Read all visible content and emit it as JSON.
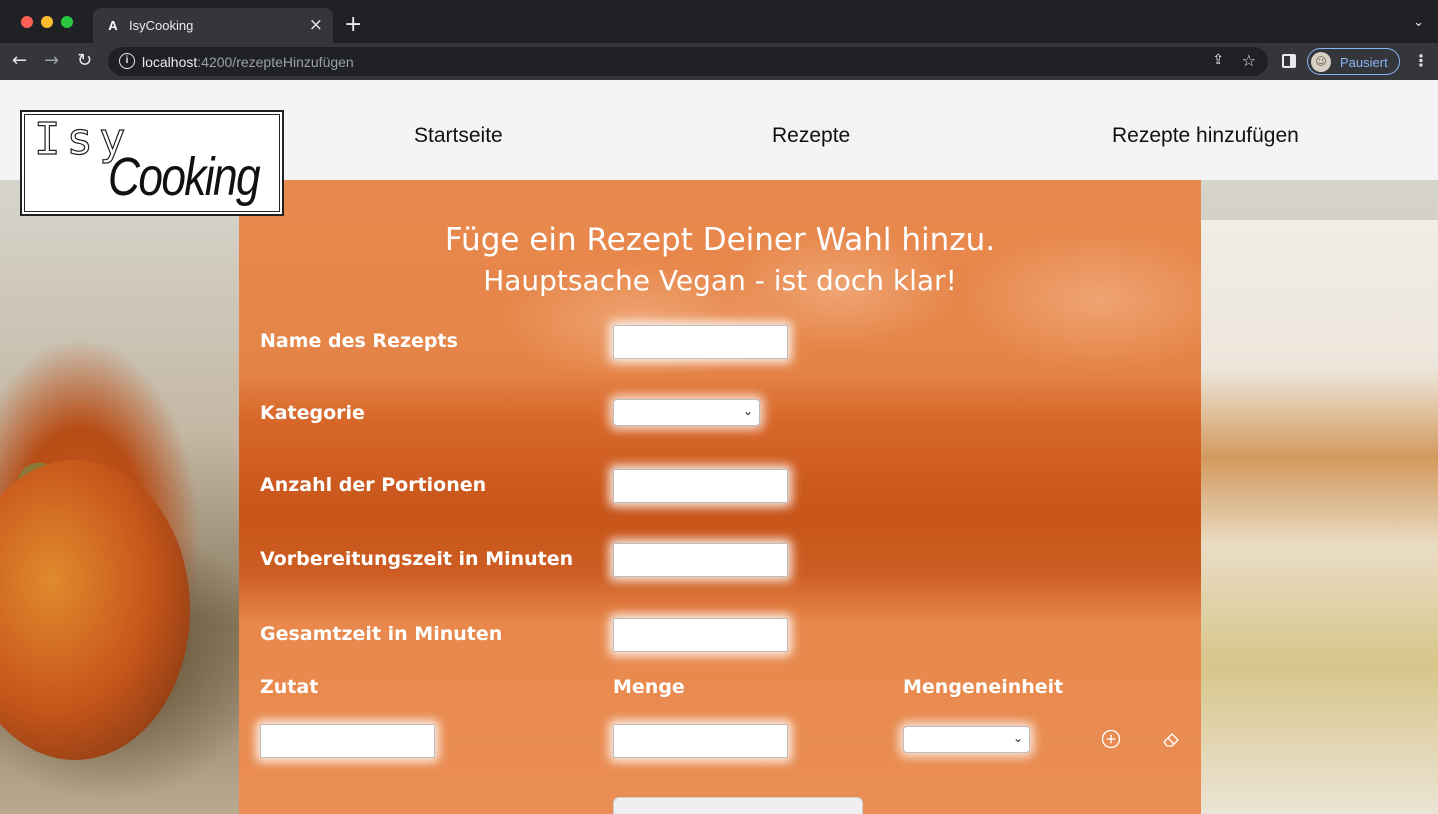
{
  "browser": {
    "tab_title": "IsyCooking",
    "tab_favicon": "A",
    "url_host": "localhost",
    "url_path": ":4200/rezepteHinzufügen",
    "profile_label": "Pausiert",
    "icons": [
      "close-icon",
      "plus-icon",
      "back-arrow-icon",
      "forward-arrow-icon",
      "reload-icon",
      "info-icon",
      "share-icon",
      "star-icon",
      "side-panel-icon",
      "avatar",
      "more-icon"
    ]
  },
  "site": {
    "logo": {
      "line1": "Isy",
      "line2": "Cooking"
    },
    "nav": [
      "Startseite",
      "Rezepte",
      "Rezepte hinzufügen"
    ]
  },
  "form": {
    "heading": "Füge ein Rezept Deiner Wahl hinzu.",
    "subheading": "Hauptsache Vegan - ist doch klar!",
    "fields": {
      "name_label": "Name des Rezepts",
      "category_label": "Kategorie",
      "portions_label": "Anzahl der Portionen",
      "prep_label": "Vorbereitungszeit in Minuten",
      "total_label": "Gesamtzeit in Minuten"
    },
    "ingredients": {
      "ingredient_label": "Zutat",
      "amount_label": "Menge",
      "unit_label": "Mengeneinheit",
      "add_icon": "plus-circle-icon",
      "remove_icon": "eraser-icon"
    }
  },
  "colors": {
    "panel": "#e5844a",
    "text": "#ffffff",
    "browser_bg": "#202124",
    "accent": "#8ab4f8"
  }
}
